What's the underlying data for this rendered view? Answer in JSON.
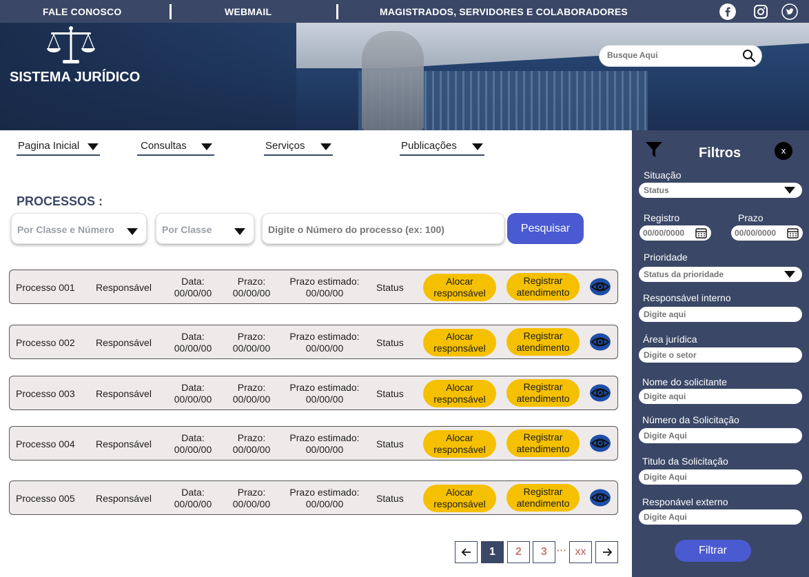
{
  "topbar": {
    "contact": "FALE CONOSCO",
    "webmail": "WEBMAIL",
    "staff": "MAGISTRADOS, SERVIDORES E COLABORADORES",
    "social": [
      "facebook-icon",
      "instagram-icon",
      "twitter-icon"
    ]
  },
  "header": {
    "brand": "SISTEMA JURÍDICO",
    "search_placeholder": "Busque Aqui"
  },
  "nav": {
    "items": [
      {
        "label": "Pagina Inicial"
      },
      {
        "label": "Consultas"
      },
      {
        "label": "Serviços"
      },
      {
        "label": "Publicações"
      }
    ]
  },
  "main": {
    "title": "PROCESSOS :",
    "filter1": "Por Classe e Número",
    "filter2": "Por Classe",
    "process_placeholder": "Digite o Número do processo (ex: 100)",
    "search_button": "Pesquisar"
  },
  "rows": [
    {
      "name": "Processo 001",
      "responsible": "Responsável",
      "date_label": "Data:",
      "date": "00/00/00",
      "deadline_label": "Prazo:",
      "deadline": "00/00/00",
      "est_label": "Prazo estimado:",
      "est": "00/00/00",
      "status": "Status",
      "allocate_1": "Alocar",
      "allocate_2": "responsável",
      "register_1": "Registrar",
      "register_2": "atendimento"
    },
    {
      "name": "Processo 002",
      "responsible": "Responsável",
      "date_label": "Data:",
      "date": "00/00/00",
      "deadline_label": "Prazo:",
      "deadline": "00/00/00",
      "est_label": "Prazo estimado:",
      "est": "00/00/00",
      "status": "Status",
      "allocate_1": "Alocar",
      "allocate_2": "responsável",
      "register_1": "Registrar",
      "register_2": "atendimento"
    },
    {
      "name": "Processo 003",
      "responsible": "Responsável",
      "date_label": "Data:",
      "date": "00/00/00",
      "deadline_label": "Prazo:",
      "deadline": "00/00/00",
      "est_label": "Prazo estimado:",
      "est": "00/00/00",
      "status": "Status",
      "allocate_1": "Alocar",
      "allocate_2": "responsável",
      "register_1": "Registrar",
      "register_2": "atendimento"
    },
    {
      "name": "Processo 004",
      "responsible": "Responsável",
      "date_label": "Data:",
      "date": "00/00/00",
      "deadline_label": "Prazo:",
      "deadline": "00/00/00",
      "est_label": "Prazo estimado:",
      "est": "00/00/00",
      "status": "Status",
      "allocate_1": "Alocar",
      "allocate_2": "responsável",
      "register_1": "Registrar",
      "register_2": "atendimento"
    },
    {
      "name": "Processo 005",
      "responsible": "Responsável",
      "date_label": "Data:",
      "date": "00/00/00",
      "deadline_label": "Prazo:",
      "deadline": "00/00/00",
      "est_label": "Prazo estimado:",
      "est": "00/00/00",
      "status": "Status",
      "allocate_1": "Alocar",
      "allocate_2": "responsável",
      "register_1": "Registrar",
      "register_2": "atendimento"
    }
  ],
  "pagination": {
    "pages": [
      "1",
      "2",
      "3"
    ],
    "ellipsis": "···",
    "last": "XX",
    "current": "1"
  },
  "filters": {
    "title": "Filtros",
    "close": "x",
    "situation_label": "Situação",
    "situation_value": "Status",
    "registro_label": "Registro",
    "registro_value": "00/00/0000",
    "prazo_label": "Prazo",
    "prazo_value": "00/00/0000",
    "priority_label": "Prioridade",
    "priority_value": "Status da prioridade",
    "internal_label": "Responsável interno",
    "internal_placeholder": "Digite aqui",
    "area_label": "Área jurídica",
    "area_placeholder": "Digite o setor",
    "requester_label": "Nome do solicitante",
    "requester_placeholder": "Digite aqui",
    "number_label": "Número da Solicitação",
    "number_placeholder": "Digite Aqui",
    "title_label": "Titulo da Solicitação",
    "title_placeholder": "Digite Aqui",
    "external_label": "Responável externo",
    "external_placeholder": "Digite Aqui",
    "filter_button": "Filtrar"
  },
  "colors": {
    "navy": "#3a4766",
    "accent": "#4a5ad0",
    "pill": "#f5c000",
    "page_link": "#c77a74"
  }
}
